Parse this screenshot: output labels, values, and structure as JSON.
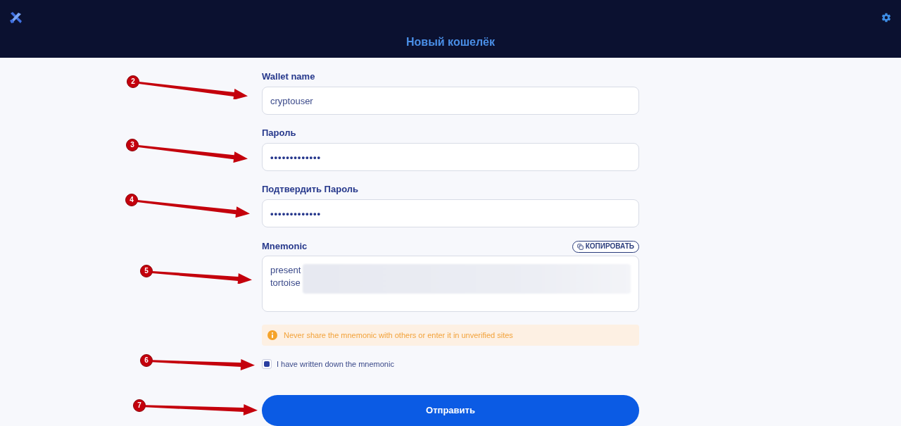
{
  "header": {
    "title": "Новый кошелёк"
  },
  "fields": [
    {
      "kind": "text",
      "label": "Wallet name",
      "value": "cryptouser",
      "marker": "2"
    },
    {
      "kind": "password",
      "label": "Пароль",
      "value": "•••••••••••••",
      "marker": "3"
    },
    {
      "kind": "password",
      "label": "Подтвердить Пароль",
      "value": "•••••••••••••",
      "marker": "4"
    }
  ],
  "mnemonic": {
    "label": "Mnemonic",
    "copy_button": "КОПИРОВАТЬ",
    "visible_words": [
      "present",
      "tortoise"
    ],
    "marker": "5"
  },
  "warning": {
    "text": "Never share the mnemonic with others or enter it in unverified sites"
  },
  "confirm": {
    "label": "I have written down the mnemonic",
    "checked": true,
    "marker": "6"
  },
  "submit": {
    "label": "Отправить",
    "marker": "7"
  }
}
